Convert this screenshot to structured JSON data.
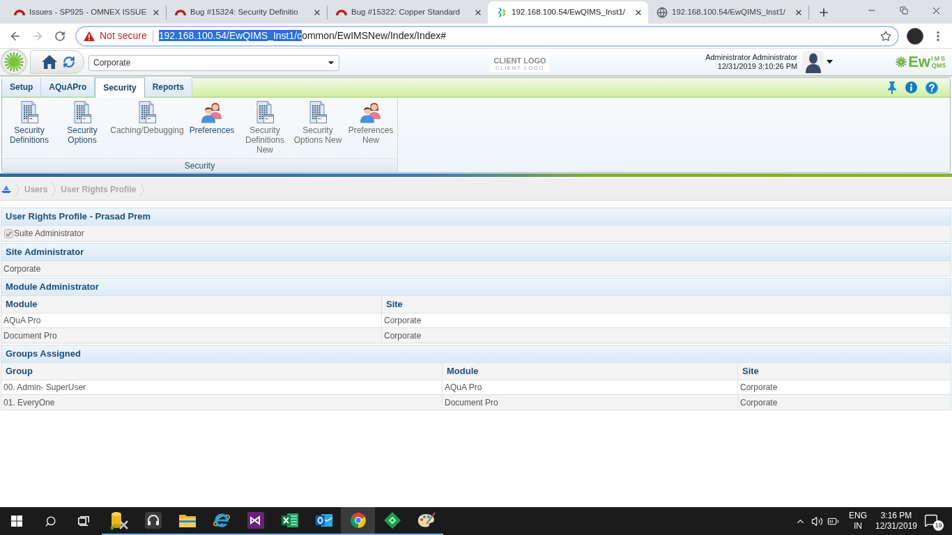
{
  "browser": {
    "tabs": [
      {
        "title": "Issues - SP925 - OMNEX ISSUE",
        "kind": "arc",
        "selected": false
      },
      {
        "title": "Bug #15324: Security Definitio",
        "kind": "arc",
        "selected": false
      },
      {
        "title": "Bug #15322: Copper Standard",
        "kind": "arc",
        "selected": false
      },
      {
        "title": "192.168.100.54/EwQIMS_Inst1/",
        "kind": "app",
        "selected": true
      },
      {
        "title": "192.168.100.54/EwQIMS_Inst1/",
        "kind": "globe",
        "selected": false
      }
    ],
    "nav": {
      "back_disabled": false,
      "forward_disabled": true
    },
    "address": {
      "security": "Not secure",
      "url_selected": "192.168.100.54/EwQIMS_Inst1/c",
      "url_rest": "ommon/EwIMSNew/Index/Index#"
    }
  },
  "header": {
    "site": "Corporate",
    "client_logo": {
      "title": "CLIENT LOGO",
      "subtitle": "CLIENT LOGO"
    },
    "user": {
      "name": "Administrator Administrator",
      "datetime": "12/31/2019 3:10:26 PM"
    },
    "brand": {
      "main": "Ew",
      "top": "IMS",
      "bottom": "QMS"
    }
  },
  "ribbon": {
    "tabs": [
      {
        "label": "Setup",
        "selected": false
      },
      {
        "label": "AQuAPro",
        "selected": false
      },
      {
        "label": "Security",
        "selected": true
      },
      {
        "label": "Reports",
        "selected": false
      }
    ],
    "buttons": [
      {
        "label": "Security Definitions",
        "kind": "building",
        "disabled": false
      },
      {
        "label": "Security Options",
        "kind": "building",
        "disabled": false
      },
      {
        "label": "Caching/Debugging",
        "kind": "building",
        "disabled": true
      },
      {
        "label": "Preferences",
        "kind": "people",
        "disabled": false
      },
      {
        "label": "Security Definitions New",
        "kind": "building",
        "disabled": true
      },
      {
        "label": "Security Options New",
        "kind": "building",
        "disabled": true
      },
      {
        "label": "Preferences New",
        "kind": "people",
        "disabled": true
      }
    ],
    "group": "Security"
  },
  "breadcrumb": [
    "Users",
    "User Rights Profile"
  ],
  "profile": {
    "title": "User Rights Profile - Prasad Prem",
    "suite_admin": {
      "label": "Suite Administrator",
      "checked": true,
      "disabled": true
    }
  },
  "site_admin": {
    "title": "Site Administrator",
    "value": "Corporate"
  },
  "module_admin": {
    "title": "Module Administrator",
    "columns": [
      "Module",
      "Site"
    ],
    "rows": [
      [
        "AQuA Pro",
        "Corporate"
      ],
      [
        "Document Pro",
        "Corporate"
      ]
    ]
  },
  "groups": {
    "title": "Groups Assigned",
    "columns": [
      "Group",
      "Module",
      "Site"
    ],
    "rows": [
      [
        "00. Admin- SuperUser",
        "AQuA Pro",
        "Corporate"
      ],
      [
        "01. EveryOne",
        "Document Pro",
        "Corporate"
      ]
    ]
  },
  "taskbar": {
    "apps": [
      {
        "kind": "database",
        "selected": false,
        "running": true
      },
      {
        "kind": "headset",
        "selected": false,
        "running": true
      },
      {
        "kind": "folder",
        "selected": false,
        "running": true
      },
      {
        "kind": "e-browser",
        "selected": false,
        "running": true
      },
      {
        "kind": "studio",
        "selected": false,
        "running": true
      },
      {
        "kind": "sheet",
        "selected": false,
        "running": true
      },
      {
        "kind": "mail",
        "selected": false,
        "running": true
      },
      {
        "kind": "wheel-browser",
        "selected": true,
        "running": true
      },
      {
        "kind": "diamond",
        "selected": false,
        "running": true
      },
      {
        "kind": "palette",
        "selected": false,
        "running": true
      }
    ],
    "tray": {
      "language": "ENG",
      "region": "IN",
      "time": "3:16 PM",
      "date": "12/31/2019",
      "notifications": "19"
    }
  }
}
